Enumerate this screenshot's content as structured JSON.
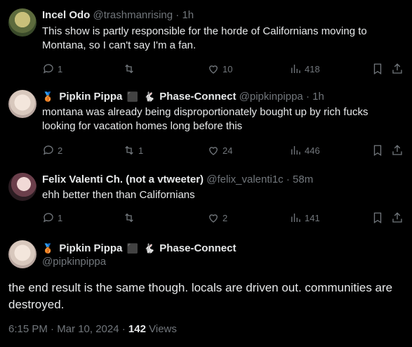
{
  "tweets": [
    {
      "name": "Incel Odo",
      "handle": "@trashmanrising",
      "time": "1h",
      "text": "This show is partly responsible for the horde of Californians moving to Montana, so I can't say I'm a fan.",
      "replies": "1",
      "retweets": "",
      "likes": "10",
      "views": "418"
    },
    {
      "name": "Pipkin Pippa",
      "name_suffix": "Phase-Connect",
      "handle": "@pipkinpippa",
      "time": "1h",
      "text": "montana was already being disproportionately bought up by rich fucks looking for vacation homes long before this",
      "replies": "2",
      "retweets": "1",
      "likes": "24",
      "views": "446"
    },
    {
      "name": "Felix Valenti Ch. (not a vtweeter)",
      "handle": "@felix_valenti1c",
      "time": "58m",
      "text": "ehh better then than Californians",
      "replies": "1",
      "retweets": "",
      "likes": "2",
      "views": "141"
    }
  ],
  "focused": {
    "name": "Pipkin Pippa",
    "name_suffix": "Phase-Connect",
    "handle": "@pipkinpippa",
    "text": "the end result is the same though. locals are driven out. communities are destroyed.",
    "timestamp": "6:15 PM · Mar 10, 2024 ·",
    "views_count": "142",
    "views_label": "Views"
  },
  "separator": "·",
  "icons": [
    "reply-icon",
    "retweet-icon",
    "like-icon",
    "views-icon",
    "bookmark-icon",
    "share-icon"
  ],
  "colors": {
    "background": "#000000",
    "text": "#e7e9ea",
    "muted": "#71767b"
  }
}
